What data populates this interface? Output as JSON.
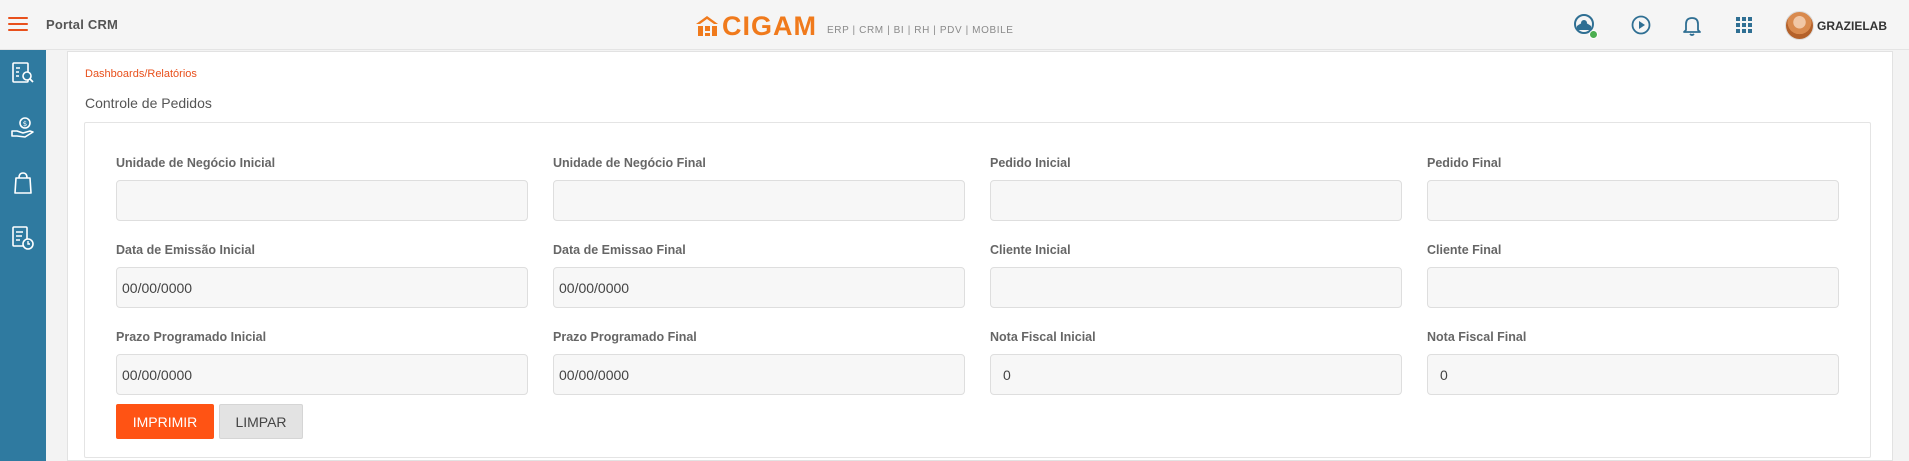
{
  "header": {
    "portal_title": "Portal CRM",
    "brand_name": "CIGAM",
    "brand_tagline": "ERP | CRM | BI | RH | PDV | MOBILE",
    "user_name": "GRAZIELAB",
    "icons": [
      "hamburger-menu-icon",
      "support-chat-icon",
      "play-video-icon",
      "notification-bell-icon",
      "apps-grid-icon"
    ],
    "accent_color": "#e8501c",
    "status_color": "#4caf50"
  },
  "sidebar": {
    "color": "#2f7aa0",
    "items": [
      {
        "icon": "dashboard-report-icon"
      },
      {
        "icon": "money-hand-icon"
      },
      {
        "icon": "shopping-bag-icon"
      },
      {
        "icon": "document-clock-icon"
      }
    ]
  },
  "main": {
    "breadcrumb": "Dashboards/Relatórios",
    "title": "Controle de Pedidos",
    "fields": {
      "un_inicial": {
        "label": "Unidade de Negócio Inicial",
        "value": ""
      },
      "un_final": {
        "label": "Unidade de Negócio Final",
        "value": ""
      },
      "pedido_inicial": {
        "label": "Pedido Inicial",
        "value": ""
      },
      "pedido_final": {
        "label": "Pedido Final",
        "value": ""
      },
      "emissao_inicial": {
        "label": "Data de Emissão Inicial",
        "value": "00/00/0000"
      },
      "emissao_final": {
        "label": "Data de Emissao Final",
        "value": "00/00/0000"
      },
      "cliente_inicial": {
        "label": "Cliente Inicial",
        "value": ""
      },
      "cliente_final": {
        "label": "Cliente Final",
        "value": ""
      },
      "prazo_inicial": {
        "label": "Prazo Programado Inicial",
        "value": "00/00/0000"
      },
      "prazo_final": {
        "label": "Prazo Programado Final",
        "value": "00/00/0000"
      },
      "nf_inicial": {
        "label": "Nota Fiscal Inicial",
        "value": "0"
      },
      "nf_final": {
        "label": "Nota Fiscal Final",
        "value": "0"
      }
    },
    "buttons": {
      "print_label": "IMPRIMIR",
      "clear_label": "LIMPAR",
      "print_color": "#ff5314"
    }
  }
}
